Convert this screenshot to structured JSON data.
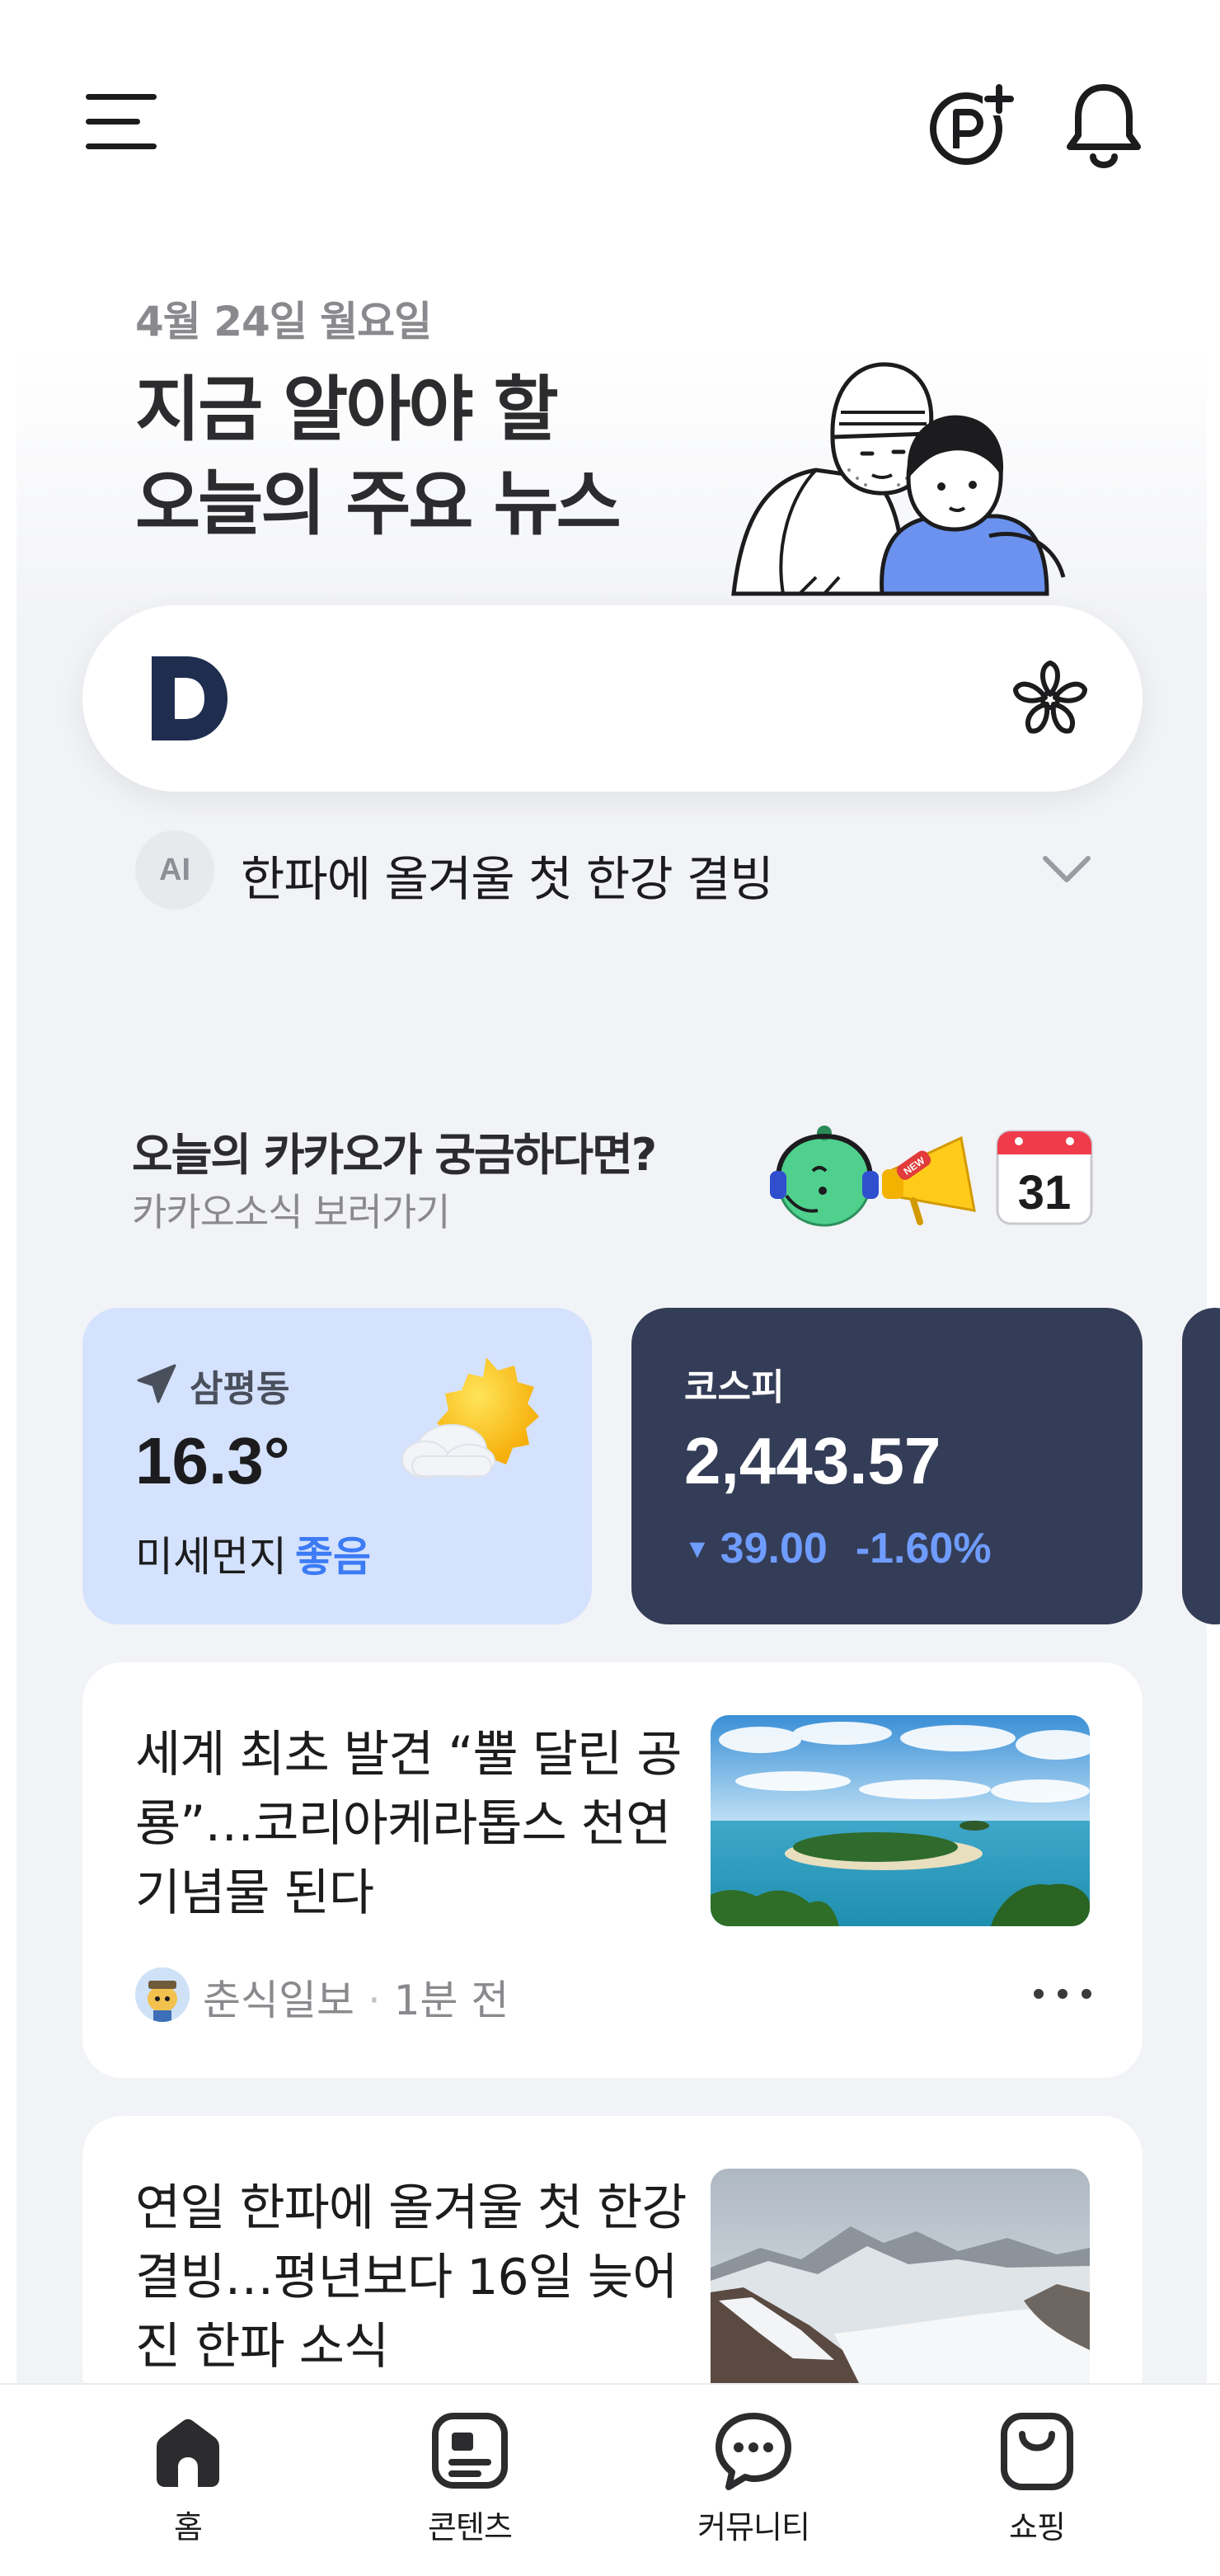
{
  "hero": {
    "date": "4월 24일 월요일",
    "headline": "지금 알아야 할\n오늘의 주요 뉴스"
  },
  "search": {
    "logo_letter": "D"
  },
  "ai_summary": {
    "badge": "AI",
    "text": "한파에 올겨울 첫 한강 결빙"
  },
  "promo": {
    "title": "오늘의 카카오가 궁금하다면?",
    "subtitle": "카카오소식 보러가기",
    "badge_new": "NEW",
    "calendar_day": "31"
  },
  "weather": {
    "location": "삼평동",
    "temperature": "16.3°",
    "dust_label": "미세먼지",
    "dust_level": "좋음",
    "accent": "#3d7bf5"
  },
  "stock": {
    "name": "코스피",
    "value": "2,443.57",
    "change": "39.00",
    "change_pct": "-1.60%",
    "direction": "down",
    "accent": "#6f9cff"
  },
  "news": [
    {
      "title": "세계 최초 발견 “뿔 달린 공룡”…코리아케라톱스 천연기념물 된다",
      "source": "춘식일보",
      "time": "1분 전"
    },
    {
      "title": "연일 한파에 올겨울 첫 한강 결빙…평년보다 16일 늦어진 한파 소식"
    }
  ],
  "bottom_nav": [
    {
      "label": "홈",
      "icon": "home-icon",
      "active": true
    },
    {
      "label": "콘텐츠",
      "icon": "contents-icon"
    },
    {
      "label": "커뮤니티",
      "icon": "chat-bubble-icon"
    },
    {
      "label": "쇼핑",
      "icon": "shopping-bag-icon"
    }
  ]
}
